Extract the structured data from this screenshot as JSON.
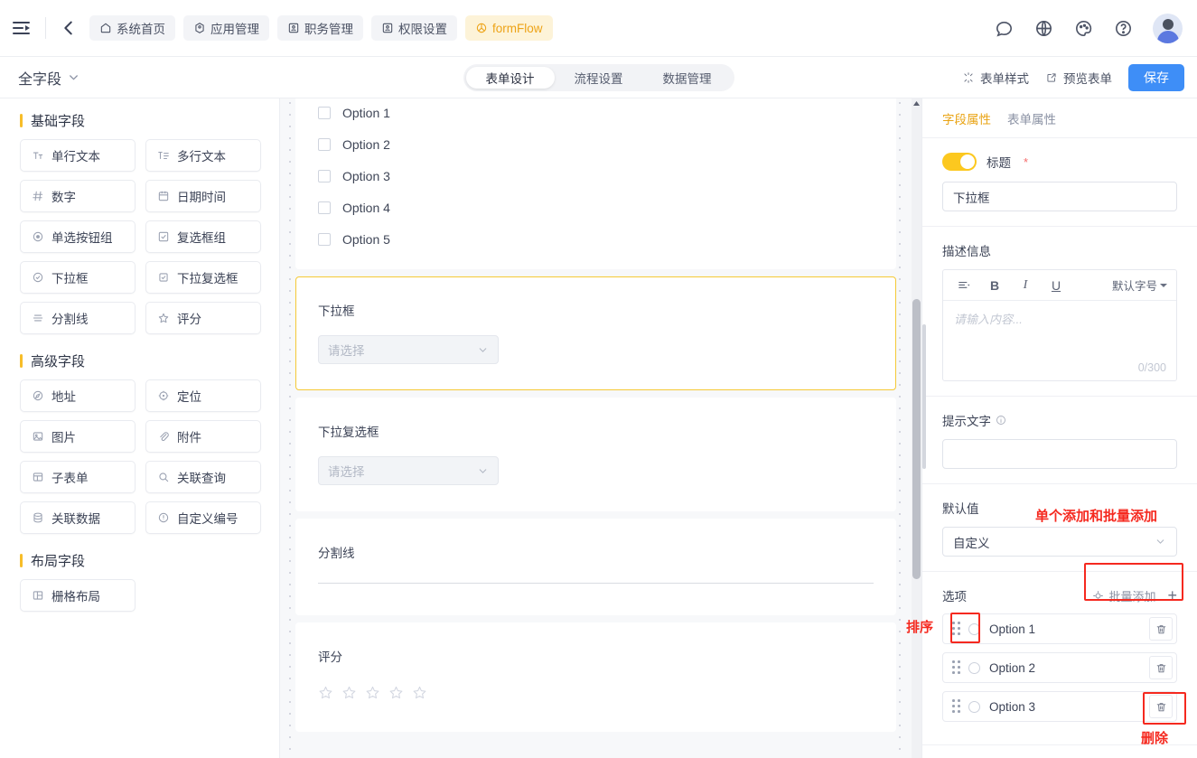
{
  "topbar": {
    "menu_icon": "menu-indent-icon",
    "back_icon": "chevron-left-icon",
    "tabs": [
      {
        "label": "系统首页",
        "icon": "home-icon",
        "accent": false
      },
      {
        "label": "应用管理",
        "icon": "app-icon",
        "accent": false
      },
      {
        "label": "职务管理",
        "icon": "user-card-icon",
        "accent": false
      },
      {
        "label": "权限设置",
        "icon": "user-card-icon",
        "accent": false
      },
      {
        "label": "formFlow",
        "icon": "flow-icon",
        "accent": true
      }
    ],
    "right_icons": [
      "chat-icon",
      "globe-icon",
      "palette-icon",
      "help-icon"
    ],
    "avatar": "user-avatar"
  },
  "toolbar": {
    "field_scope": "全字段",
    "tabs": [
      {
        "label": "表单设计",
        "active": true
      },
      {
        "label": "流程设置",
        "active": false
      },
      {
        "label": "数据管理",
        "active": false
      }
    ],
    "form_style": "表单样式",
    "preview": "预览表单",
    "save": "保存"
  },
  "palette": {
    "groups": [
      {
        "title": "基础字段",
        "items": [
          {
            "label": "单行文本",
            "icon": "text-single-icon"
          },
          {
            "label": "多行文本",
            "icon": "text-multi-icon"
          },
          {
            "label": "数字",
            "icon": "hash-icon"
          },
          {
            "label": "日期时间",
            "icon": "calendar-icon"
          },
          {
            "label": "单选按钮组",
            "icon": "radio-icon"
          },
          {
            "label": "复选框组",
            "icon": "checkbox-icon"
          },
          {
            "label": "下拉框",
            "icon": "select-icon"
          },
          {
            "label": "下拉复选框",
            "icon": "multiselect-icon"
          },
          {
            "label": "分割线",
            "icon": "divider-icon"
          },
          {
            "label": "评分",
            "icon": "star-icon"
          }
        ]
      },
      {
        "title": "高级字段",
        "items": [
          {
            "label": "地址",
            "icon": "address-icon"
          },
          {
            "label": "定位",
            "icon": "location-icon"
          },
          {
            "label": "图片",
            "icon": "image-icon"
          },
          {
            "label": "附件",
            "icon": "attachment-icon"
          },
          {
            "label": "子表单",
            "icon": "subform-icon"
          },
          {
            "label": "关联查询",
            "icon": "search-icon"
          },
          {
            "label": "关联数据",
            "icon": "database-icon"
          },
          {
            "label": "自定义编号",
            "icon": "number-icon"
          }
        ]
      },
      {
        "title": "布局字段",
        "items": [
          {
            "label": "栅格布局",
            "icon": "grid-icon"
          }
        ]
      }
    ]
  },
  "canvas": {
    "checkbox_card": {
      "options": [
        "Option 1",
        "Option 2",
        "Option 3",
        "Option 4",
        "Option 5"
      ]
    },
    "select_card": {
      "label": "下拉框",
      "placeholder": "请选择",
      "selected": true
    },
    "multiselect_card": {
      "label": "下拉复选框",
      "placeholder": "请选择"
    },
    "divider_card": {
      "label": "分割线"
    },
    "rating_card": {
      "label": "评分",
      "stars": 5
    }
  },
  "props": {
    "tabs": [
      {
        "label": "字段属性",
        "active": true
      },
      {
        "label": "表单属性",
        "active": false
      }
    ],
    "title_toggle_label": "标题",
    "title_required_mark": "*",
    "title_value": "下拉框",
    "desc_label": "描述信息",
    "editor": {
      "align_icon": "align-left-icon",
      "bold": "B",
      "italic": "I",
      "underline": "U",
      "font_size": "默认字号",
      "placeholder": "请输入内容...",
      "counter": "0/300"
    },
    "hint_label": "提示文字",
    "hint_value": "",
    "hint_placeholder": "",
    "default_label": "默认值",
    "default_value": "自定义",
    "options_label": "选项",
    "batch_add": "批量添加",
    "add_plus": "+",
    "options": [
      {
        "text": "Option 1"
      },
      {
        "text": "Option 2"
      },
      {
        "text": "Option 3"
      }
    ]
  },
  "annotations": [
    {
      "text": "单个添加和批量添加",
      "name": "annotation-batch-add"
    },
    {
      "text": "排序",
      "name": "annotation-sort"
    },
    {
      "text": "删除",
      "name": "annotation-delete"
    }
  ],
  "colors": {
    "accent_yellow": "#f7bd29",
    "toggle_on": "#fcc81f",
    "save_blue": "#3e8ef7",
    "annotation_red": "#f5291f"
  }
}
